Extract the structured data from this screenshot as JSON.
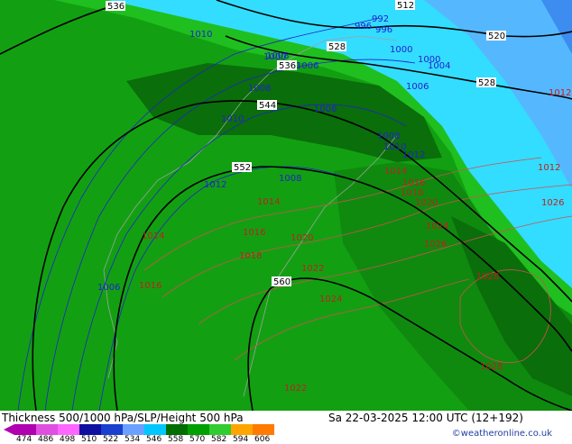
{
  "title": "Thickness 500/1000 hPa/SLP/Height 500 hPa",
  "datetime": "Sa 22-03-2025 12:00 UTC (12+192)",
  "credit": "©weatheronline.co.uk",
  "colorbar": {
    "ticks": [
      "474",
      "486",
      "498",
      "510",
      "522",
      "534",
      "546",
      "558",
      "570",
      "582",
      "594",
      "606"
    ],
    "colors": [
      "#b000b0",
      "#e050e0",
      "#ff66ff",
      "#1010a0",
      "#1a40d0",
      "#6aa0ff",
      "#00c8ff",
      "#006e00",
      "#00a000",
      "#30cc30",
      "#ffa500",
      "#ff7a00"
    ]
  },
  "colors": {
    "deep_green": "#0a6e0a",
    "mid_green": "#0f8a0f",
    "green": "#12a012",
    "light_green": "#1fbf1f",
    "cyan": "#33ddff",
    "light_blue": "#55b8ff",
    "blue": "#3d8cf0",
    "height_contour": "#000000",
    "slp_low": "#2222cc",
    "slp_high": "#d05050"
  },
  "height_labels": [
    "536",
    "512",
    "528",
    "520",
    "536",
    "528",
    "544",
    "552",
    "560"
  ],
  "slp_low_labels": [
    "992",
    "996",
    "996",
    "1000",
    "1004",
    "1000",
    "1006",
    "1006",
    "1010",
    "1000",
    "1006",
    "1008",
    "1008",
    "1010",
    "1012",
    "1010",
    "1006",
    "1008",
    "1012",
    "1008"
  ],
  "slp_high_labels": [
    "1014",
    "1016",
    "1018",
    "1020",
    "1024",
    "1026",
    "1028",
    "1014",
    "1018",
    "1016",
    "1020",
    "1022",
    "1024",
    "1016",
    "1028",
    "1022",
    "1014",
    "1026",
    "1012",
    "1012"
  ]
}
